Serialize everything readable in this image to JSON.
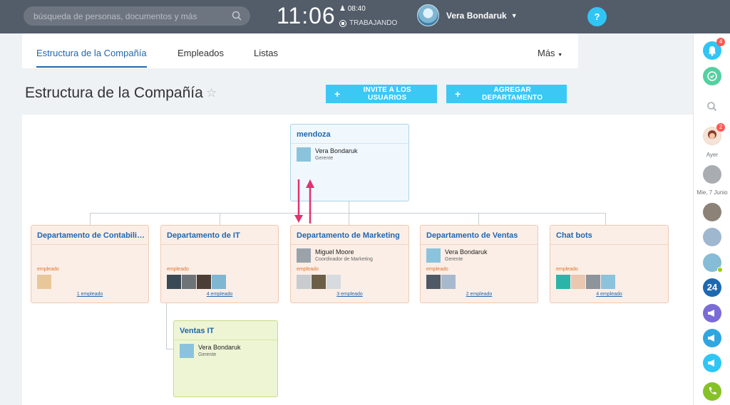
{
  "search": {
    "placeholder": "búsqueda de personas, documentos y más",
    "icon": "search-icon"
  },
  "clock": {
    "time": "11:06",
    "alarm": "08:40",
    "status": "TRABAJANDO"
  },
  "user": {
    "name": "Vera Bondaruk"
  },
  "help": {
    "label": "?"
  },
  "tabs": [
    {
      "label": "Estructura de la Compañía"
    },
    {
      "label": "Empleados"
    },
    {
      "label": "Listas"
    },
    {
      "label": "Más"
    }
  ],
  "page": {
    "title": "Estructura de la Compañía"
  },
  "buttons": {
    "invite": "INVITE A LOS USUARIOS",
    "add_department": "AGREGAR DEPARTAMENTO"
  },
  "rightbar": {
    "notifications_badge": "4",
    "chat_badge": "2",
    "label_yesterday": "Ayer",
    "label_date": "Mie, 7 Junio",
    "brand": "24"
  },
  "structure": {
    "root": {
      "title": "mendoza",
      "person": "Vera Bondaruk",
      "role": "Gerente"
    },
    "departments": [
      {
        "title": "Departamento de Contabilidad",
        "emp_label": "empleado",
        "count": "1 empleado"
      },
      {
        "title": "Departamento de IT",
        "emp_label": "empleado",
        "count": "4 empleado"
      },
      {
        "title": "Departamento de Marketing",
        "person": "Miguel Moore",
        "role": "Coordinador de Marketing",
        "emp_label": "empleado",
        "count": "3 empleado"
      },
      {
        "title": "Departamento de Ventas",
        "person": "Vera Bondaruk",
        "role": "Gerente",
        "emp_label": "empleado",
        "count": "2 empleado"
      },
      {
        "title": "Chat bots",
        "emp_label": "empleado",
        "count": "4 empleado"
      }
    ],
    "sub": {
      "title": "Ventas IT",
      "person": "Vera Bondaruk",
      "role": "Gerente"
    }
  },
  "colors": {
    "accent": "#2fc6f6",
    "link": "#2067b0",
    "arrow": "#e0336f",
    "topbar": "#535c69"
  }
}
